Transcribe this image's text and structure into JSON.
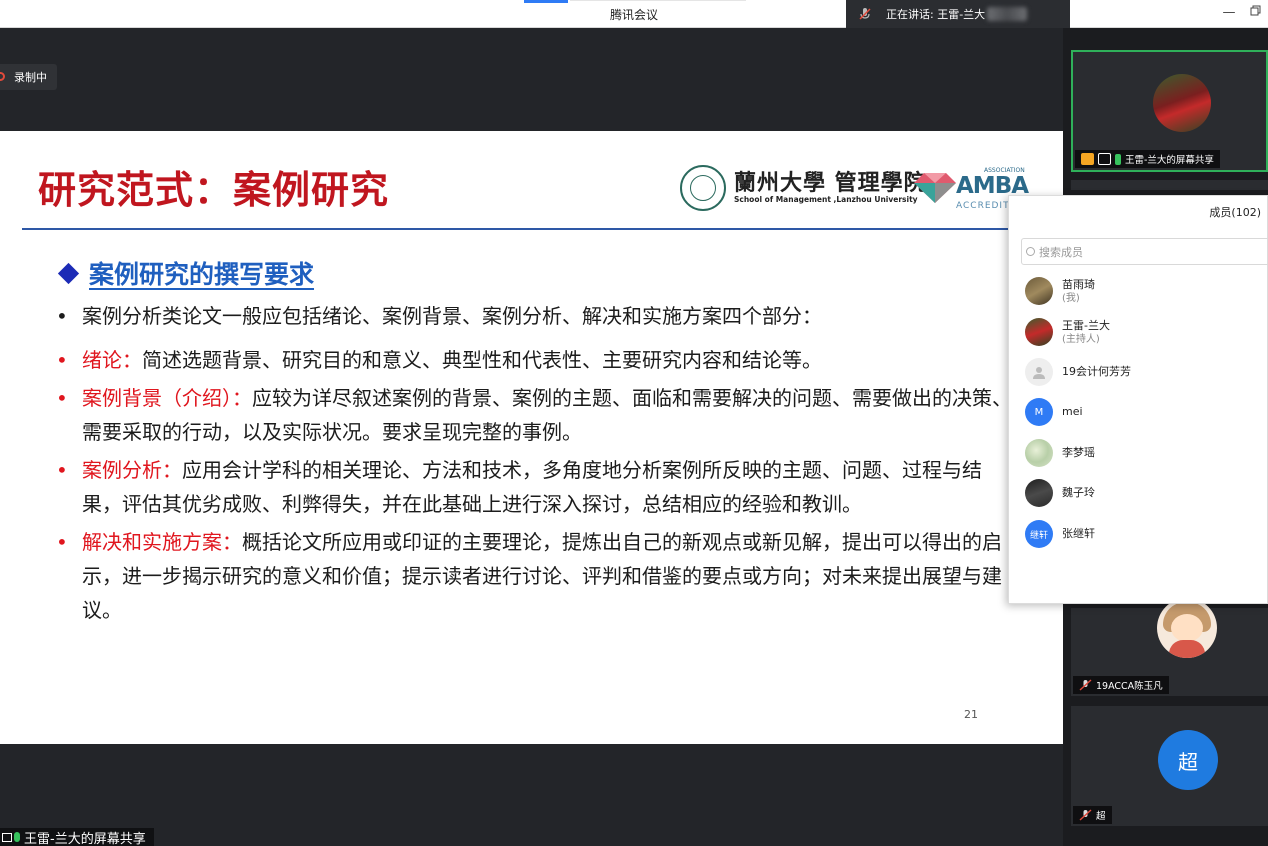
{
  "window": {
    "title": "腾讯会议",
    "speaking_label": "正在讲话: 王雷-兰大"
  },
  "recording": {
    "label": "录制中"
  },
  "slide": {
    "title": "研究范式：案例研究",
    "logo": {
      "university_cn": "蘭州大學 管理學院",
      "university_en": "School of Management ,Lanzhou University",
      "accreditation": "AMBA",
      "accreditation_small": "ASSOCIATION",
      "accreditation_sub": "ACCREDITED"
    },
    "subheading": "案例研究的撰写要求",
    "intro": "案例分析类论文一般应包括绪论、案例背景、案例分析、解决和实施方案四个部分：",
    "items": [
      {
        "term": "绪论：",
        "text": "简述选题背景、研究目的和意义、典型性和代表性、主要研究内容和结论等。"
      },
      {
        "term": "案例背景（介绍）：",
        "text": "应较为详尽叙述案例的背景、案例的主题、面临和需要解决的问题、需要做出的决策、需要采取的行动，以及实际状况。要求呈现完整的事例。"
      },
      {
        "term": "案例分析：",
        "text": "应用会计学科的相关理论、方法和技术，多角度地分析案例所反映的主题、问题、过程与结果，评估其优劣成败、利弊得失，并在此基础上进行深入探讨，总结相应的经验和教训。"
      },
      {
        "term": "解决和实施方案：",
        "text": "概括论文所应用或印证的主要理论，提炼出自己的新观点或新见解，提出可以得出的启示，进一步揭示研究的意义和价值；提示读者进行讨论、评判和借鉴的要点或方向；对未来提出展望与建议。"
      }
    ],
    "bullet": "•",
    "page_number": "21"
  },
  "screen_share_label": "王雷-兰大的屏幕共享",
  "video_tiles": [
    {
      "label": "王雷-兰大的屏幕共享",
      "active": true
    },
    {
      "label": "19ACCA陈玉凡"
    },
    {
      "label": "超",
      "avatar_text": "超"
    }
  ],
  "members_panel": {
    "header": "成员(102)",
    "search_placeholder": "搜索成员",
    "members": [
      {
        "name": "苗雨琦",
        "role": "(我)",
        "avatar": "photo"
      },
      {
        "name": "王雷-兰大",
        "role": "(主持人)",
        "avatar": "photo"
      },
      {
        "name": "19会计何芳芳",
        "role": "",
        "avatar": "default"
      },
      {
        "name": "mei",
        "role": "",
        "avatar": "M",
        "avatar_color": "#2f7bf5"
      },
      {
        "name": "李梦瑶",
        "role": "",
        "avatar": "photo"
      },
      {
        "name": "魏子玲",
        "role": "",
        "avatar": "photo"
      },
      {
        "name": "张继轩",
        "role": "",
        "avatar": "继轩",
        "avatar_color": "#2f7bf5"
      }
    ]
  },
  "colors": {
    "accent": "#2f7bf5",
    "slide_title": "#c0161f",
    "term_red": "#e0161e",
    "subhead_blue": "#1f5fbf",
    "active_border": "#2fb15a"
  }
}
